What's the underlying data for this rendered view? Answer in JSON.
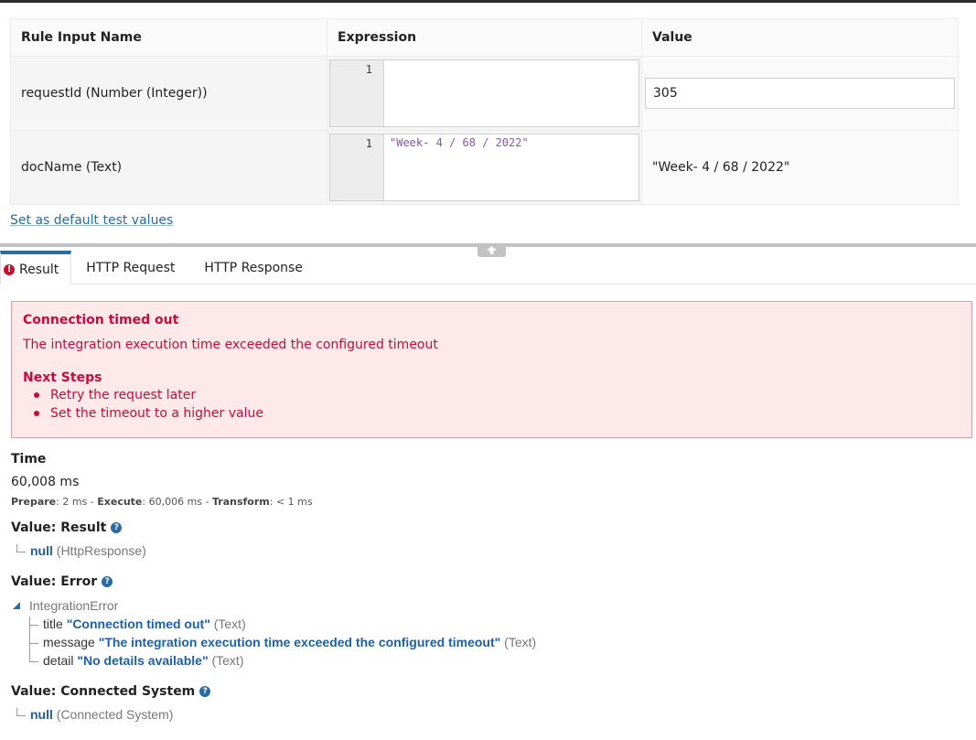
{
  "rule_table": {
    "headers": [
      "Rule Input Name",
      "Expression",
      "Value"
    ],
    "rows": [
      {
        "name": "requestId (Number (Integer))",
        "line": "1",
        "expression": "",
        "value": "305"
      },
      {
        "name": "docName (Text)",
        "line": "1",
        "expression": "\"Week- 4 / 68 / 2022\"",
        "value": "\"Week- 4 / 68 / 2022\""
      }
    ]
  },
  "default_link": "Set as default test values",
  "tabs": [
    "Result",
    "HTTP Request",
    "HTTP Response"
  ],
  "error": {
    "title": "Connection timed out",
    "message": "The integration execution time exceeded the configured timeout",
    "next_steps_label": "Next Steps",
    "steps": [
      "Retry the request later",
      "Set the timeout to a higher value"
    ]
  },
  "time": {
    "label": "Time",
    "value": "60,008 ms",
    "prepare_label": "Prepare",
    "prepare": ": 2 ms - ",
    "execute_label": "Execute",
    "execute": ": 60,006 ms - ",
    "transform_label": "Transform",
    "transform": ": < 1 ms"
  },
  "value_result": {
    "label": "Value: Result",
    "value": "null",
    "type": "(HttpResponse)"
  },
  "value_error": {
    "label": "Value: Error",
    "root": "IntegrationError",
    "fields": [
      {
        "key": "title",
        "value": "\"Connection timed out\"",
        "type": "(Text)"
      },
      {
        "key": "message",
        "value": "\"The integration execution time exceeded the configured timeout\"",
        "type": "(Text)"
      },
      {
        "key": "detail",
        "value": "\"No details available\"",
        "type": "(Text)"
      }
    ]
  },
  "value_connected": {
    "label": "Value: Connected System",
    "value": "null",
    "type": "(Connected System)"
  },
  "colors": {
    "accent": "#2a6aa5",
    "error": "#c40d3c",
    "error_bg": "#fde9ea"
  }
}
